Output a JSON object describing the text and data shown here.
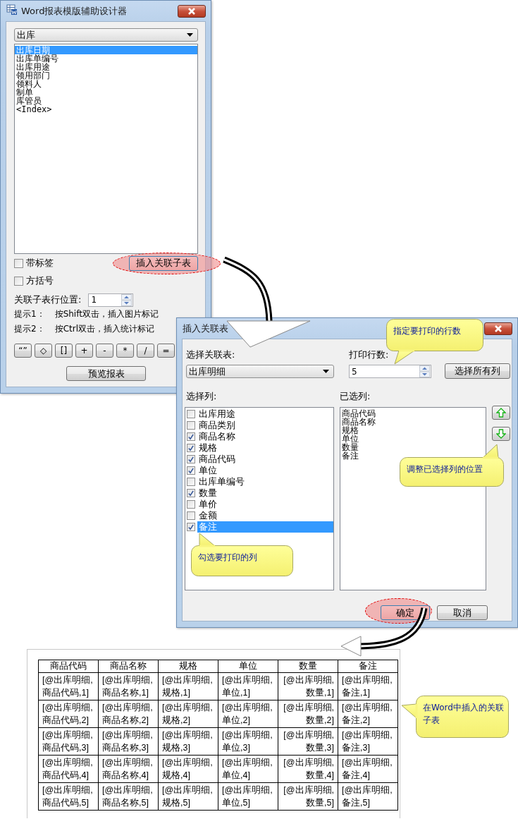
{
  "designer_window": {
    "title": "Word报表模版辅助设计器",
    "table_select": {
      "value": "出库"
    },
    "fields": [
      {
        "label": "出库日期",
        "selected": true
      },
      {
        "label": "出库单编号",
        "selected": false
      },
      {
        "label": "出库用途",
        "selected": false
      },
      {
        "label": "领用部门",
        "selected": false
      },
      {
        "label": "领料人",
        "selected": false
      },
      {
        "label": "制单",
        "selected": false
      },
      {
        "label": "库管员",
        "selected": false
      },
      {
        "label": "<Index>",
        "selected": false
      }
    ],
    "with_label": {
      "label": "带标签",
      "checked": false
    },
    "insert_button": "插入关联子表",
    "brackets": {
      "label": "方括号",
      "checked": false
    },
    "row_position": {
      "label": "关联子表行位置:",
      "value": "1"
    },
    "hints": [
      {
        "label": "提示1：",
        "text": "按Shift双击，插入图片标记"
      },
      {
        "label": "提示2：",
        "text": "按Ctrl双击，插入统计标记"
      }
    ],
    "symbol_buttons": [
      "“”",
      "◇",
      "[]",
      "+",
      "-",
      "*",
      "/",
      "="
    ],
    "preview_button": "预览报表"
  },
  "insert_dialog": {
    "title": "插入关联表",
    "table_label": "选择关联表:",
    "table_select": {
      "value": "出库明细"
    },
    "rows_label": "打印行数:",
    "rows_field": {
      "value": "5"
    },
    "select_all_button": "选择所有列",
    "columns_label": "选择列:",
    "columns": [
      {
        "label": "出库用途",
        "checked": false,
        "selected": false
      },
      {
        "label": "商品类别",
        "checked": false,
        "selected": false
      },
      {
        "label": "商品名称",
        "checked": true,
        "selected": false
      },
      {
        "label": "规格",
        "checked": true,
        "selected": false
      },
      {
        "label": "商品代码",
        "checked": true,
        "selected": false
      },
      {
        "label": "单位",
        "checked": true,
        "selected": false
      },
      {
        "label": "出库单编号",
        "checked": false,
        "selected": false
      },
      {
        "label": "数量",
        "checked": true,
        "selected": false
      },
      {
        "label": "单价",
        "checked": false,
        "selected": false
      },
      {
        "label": "金额",
        "checked": false,
        "selected": false
      },
      {
        "label": "备注",
        "checked": true,
        "selected": true
      }
    ],
    "chosen_label": "已选列:",
    "chosen": [
      "商品代码",
      "商品名称",
      "规格",
      "单位",
      "数量",
      "备注"
    ],
    "ok_button": "确定",
    "cancel_button": "取消"
  },
  "callouts": [
    {
      "text": "指定要打印的行数"
    },
    {
      "text": "调整已选择列的位置"
    },
    {
      "text": "勾选要打印的列"
    },
    {
      "text": "在Word中插入的关联子表"
    }
  ],
  "word_table": {
    "columns": [
      "商品代码",
      "商品名称",
      "规格",
      "单位",
      "数量",
      "备注"
    ],
    "rows": [
      [
        "[@出库明细,\n商品代码,1]",
        "[@出库明细,\n商品名称,1]",
        "[@出库明细,\n规格,1]",
        "[@出库明细,\n单位,1]",
        "[@出库明细,\n数量,1]",
        "[@出库明细,\n备注,1]"
      ],
      [
        "[@出库明细,\n商品代码,2]",
        "[@出库明细,\n商品名称,2]",
        "[@出库明细,\n规格,2]",
        "[@出库明细,\n单位,2]",
        "[@出库明细,\n数量,2]",
        "[@出库明细,\n备注,2]"
      ],
      [
        "[@出库明细,\n商品代码,3]",
        "[@出库明细,\n商品名称,3]",
        "[@出库明细,\n规格,3]",
        "[@出库明细,\n单位,3]",
        "[@出库明细,\n数量,3]",
        "[@出库明细,\n备注,3]"
      ],
      [
        "[@出库明细,\n商品代码,4]",
        "[@出库明细,\n商品名称,4]",
        "[@出库明细,\n规格,4]",
        "[@出库明细,\n单位,4]",
        "[@出库明细,\n数量,4]",
        "[@出库明细,\n备注,4]"
      ],
      [
        "[@出库明细,\n商品代码,5]",
        "[@出库明细,\n商品名称,5]",
        "[@出库明细,\n规格,5]",
        "[@出库明细,\n单位,5]",
        "[@出库明细,\n数量,5]",
        "[@出库明细,\n备注,5]"
      ]
    ]
  }
}
